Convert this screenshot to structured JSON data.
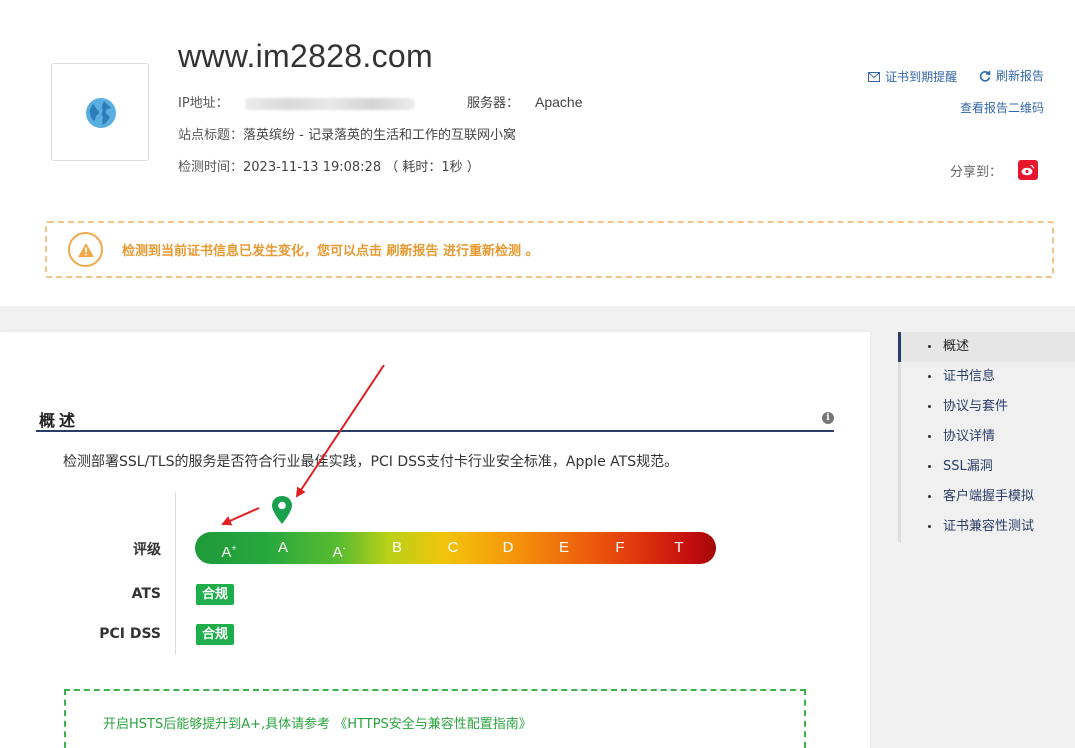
{
  "site": {
    "domain": "www.im2828.com",
    "ip_label": "IP地址：",
    "server_label": "服务器：",
    "server_value": "Apache",
    "title_label": "站点标题：",
    "title_value": "落英缤纷 - 记录落英的生活和工作的互联网小窝",
    "time_label": "检测时间：",
    "time_value": "2023-11-13 19:08:28 （ 耗时：1秒 ）"
  },
  "actions": {
    "cert_reminder": "证书到期提醒",
    "refresh_report": "刷新报告",
    "qr_code": "查看报告二维码",
    "share_label": "分享到："
  },
  "alert": {
    "message": "检测到当前证书信息已发生变化，您可以点击 刷新报告 进行重新检测 。"
  },
  "overview": {
    "title": "概述",
    "description": "检测部署SSL/TLS的服务是否符合行业最佳实践，PCI DSS支付卡行业安全标准，Apple ATS规范。",
    "rating_label": "评级",
    "grades": [
      "A",
      "A",
      "A",
      "B",
      "C",
      "D",
      "E",
      "F",
      "T"
    ],
    "grade_sups": [
      "+",
      "",
      "-",
      "",
      "",
      "",
      "",
      "",
      ""
    ],
    "current_grade": "A",
    "ats_label": "ATS",
    "ats_status": "合规",
    "pci_label": "PCI DSS",
    "pci_status": "合规",
    "hsts_text": "开启HSTS后能够提升到A+,具体请参考",
    "hsts_link": "《HTTPS安全与兼容性配置指南》"
  },
  "nav": [
    {
      "label": "概述",
      "active": true
    },
    {
      "label": "证书信息",
      "active": false
    },
    {
      "label": "协议与套件",
      "active": false
    },
    {
      "label": "协议详情",
      "active": false
    },
    {
      "label": "SSL漏洞",
      "active": false
    },
    {
      "label": "客户端握手模拟",
      "active": false
    },
    {
      "label": "证书兼容性测试",
      "active": false
    }
  ],
  "colors": {
    "accent": "#2a3d66",
    "link": "#3366aa",
    "warning": "#e89a32",
    "success": "#1fae4c",
    "annotation_arrow": "#e02020"
  }
}
